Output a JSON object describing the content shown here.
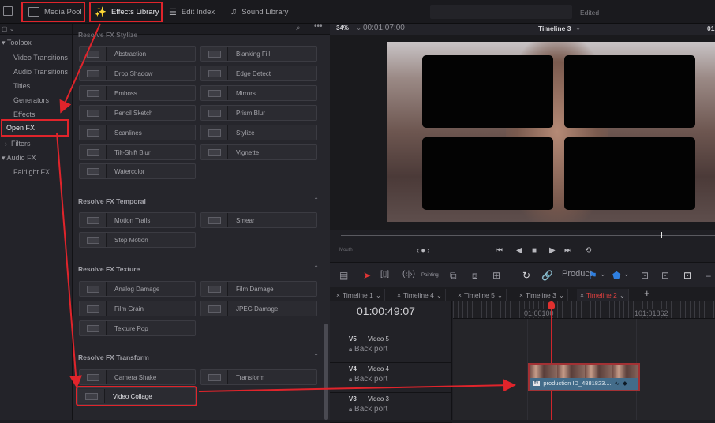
{
  "topbar": {
    "media_pool": "Media Pool",
    "effects_library": "Effects Library",
    "edit_index": "Edit Index",
    "sound_library": "Sound Library",
    "status": "Edited"
  },
  "tree": {
    "items": [
      {
        "label": "Toolbox",
        "expander": "▾"
      },
      {
        "label": "Video Transitions"
      },
      {
        "label": "Audio Transitions"
      },
      {
        "label": "Titles"
      },
      {
        "label": "Generators"
      },
      {
        "label": "Effects"
      },
      {
        "label": "Open FX",
        "expander": "▾"
      },
      {
        "label": "Filters",
        "expander": "›"
      },
      {
        "label": "Audio FX",
        "expander": "▾"
      },
      {
        "label": "Fairlight FX"
      }
    ]
  },
  "effects": {
    "stylize_partial_title": "Resolve FX Stylize",
    "stylize": [
      "Abstraction",
      "Blanking Fill",
      "Drop Shadow",
      "Edge Detect",
      "Emboss",
      "Mirrors",
      "Pencil Sketch",
      "Prism Blur",
      "Scanlines",
      "Stylize",
      "Tilt-Shift Blur",
      "Vignette",
      "Watercolor"
    ],
    "temporal_title": "Resolve FX Temporal",
    "temporal": [
      "Motion Trails",
      "Smear",
      "Stop Motion"
    ],
    "texture_title": "Resolve FX Texture",
    "texture": [
      "Analog Damage",
      "Film Damage",
      "Film Grain",
      "JPEG Damage",
      "Texture Pop"
    ],
    "transform_title": "Resolve FX Transform",
    "transform": [
      "Camera Shake",
      "Transform",
      "Video Collage"
    ]
  },
  "viewer": {
    "zoom": "34%",
    "timecode": "00:01:07:00",
    "timeline_name": "Timeline 3",
    "right_tc": "01",
    "label_mouth": "Mouth"
  },
  "toolbar2": {
    "painting": "Painting",
    "product": "Product"
  },
  "timeline_tabs": [
    {
      "label": "Timeline 1",
      "active": false
    },
    {
      "label": "Timeline 4",
      "active": false
    },
    {
      "label": "Timeline 5",
      "active": false
    },
    {
      "label": "Timeline 3",
      "active": false
    },
    {
      "label": "Timeline 2",
      "active": true
    }
  ],
  "timeline": {
    "current_tc": "01:00:49:07",
    "ruler_marks": [
      "01:00100",
      "101:01862"
    ],
    "tracks": [
      {
        "id": "V5",
        "name": "Video 5",
        "sub": "Back port"
      },
      {
        "id": "V4",
        "name": "Video 4",
        "sub": "Back port"
      },
      {
        "id": "V3",
        "name": "Video 3",
        "sub": "Back port"
      }
    ],
    "clip_name": "production ID_4881823....",
    "clip_badge": "fx"
  },
  "colors": {
    "highlight": "#e0242b",
    "active_tab": "#e0403f",
    "clip": "#436c8a"
  }
}
